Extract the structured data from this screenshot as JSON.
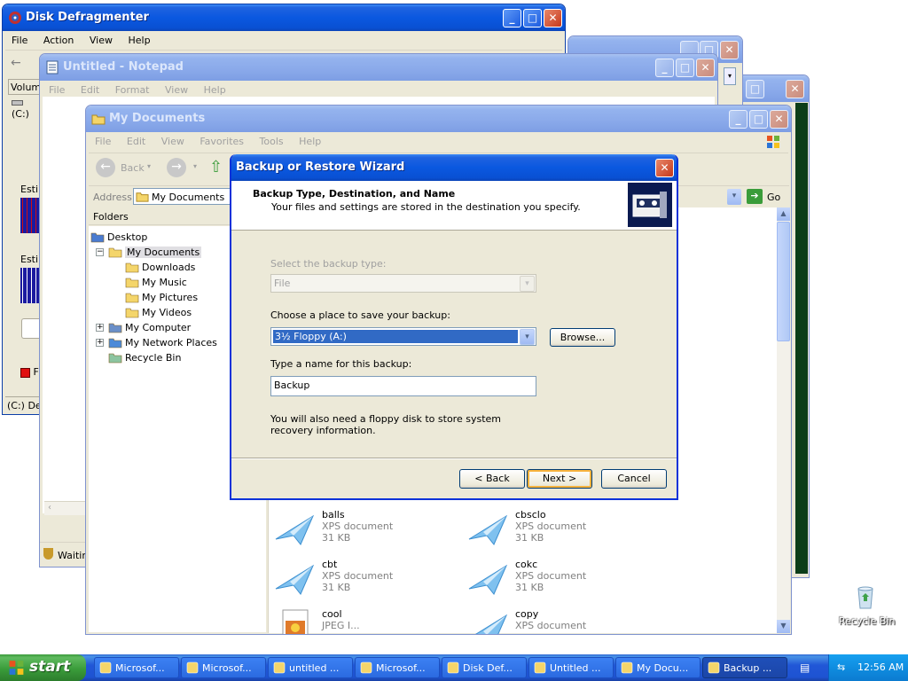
{
  "windows": {
    "defrag": {
      "title": "Disk Defragmenter",
      "menu": [
        "File",
        "Action",
        "View",
        "Help"
      ],
      "col_volume": "Volum",
      "drive": "(C:)",
      "estimated1": "Estim",
      "estimated2": "Estim",
      "legend_frag": "F",
      "status": "(C:) Def"
    },
    "notepad": {
      "title": "Untitled - Notepad",
      "menu": [
        "File",
        "Edit",
        "Format",
        "View",
        "Help"
      ],
      "status_text": "Waitin"
    },
    "mydocs": {
      "title": "My Documents",
      "menu": [
        "File",
        "Edit",
        "View",
        "Favorites",
        "Tools",
        "Help"
      ],
      "back_label": "Back",
      "address_label": "Address",
      "address_value": "My Documents",
      "go_label": "Go",
      "folders_label": "Folders",
      "tree": [
        {
          "label": "Desktop",
          "level": 0,
          "icon": "desktop-icon",
          "exp": ""
        },
        {
          "label": "My Documents",
          "level": 1,
          "icon": "folder-open-icon",
          "exp": "−",
          "selected": true
        },
        {
          "label": "Downloads",
          "level": 2,
          "icon": "folder-icon",
          "exp": ""
        },
        {
          "label": "My Music",
          "level": 2,
          "icon": "music-folder-icon",
          "exp": ""
        },
        {
          "label": "My Pictures",
          "level": 2,
          "icon": "pictures-folder-icon",
          "exp": ""
        },
        {
          "label": "My Videos",
          "level": 2,
          "icon": "videos-folder-icon",
          "exp": ""
        },
        {
          "label": "My Computer",
          "level": 1,
          "icon": "computer-icon",
          "exp": "+"
        },
        {
          "label": "My Network Places",
          "level": 1,
          "icon": "network-icon",
          "exp": "+"
        },
        {
          "label": "Recycle Bin",
          "level": 1,
          "icon": "recycle-bin-icon",
          "exp": ""
        }
      ],
      "files": [
        {
          "name": "balls",
          "type": "XPS document",
          "size": "31 KB",
          "icon": "xps-icon"
        },
        {
          "name": "cbsclo",
          "type": "XPS document",
          "size": "31 KB",
          "icon": "xps-icon"
        },
        {
          "name": "cbt",
          "type": "XPS document",
          "size": "31 KB",
          "icon": "xps-icon"
        },
        {
          "name": "cokc",
          "type": "XPS document",
          "size": "31 KB",
          "icon": "xps-icon"
        },
        {
          "name": "cool",
          "type": "JPEG I...",
          "size": "",
          "icon": "jpeg-icon"
        },
        {
          "name": "copy",
          "type": "XPS document",
          "size": "",
          "icon": "xps-icon"
        }
      ]
    },
    "wizard": {
      "title": "Backup or Restore Wizard",
      "heading": "Backup Type, Destination, and Name",
      "subheading": "Your files and settings are stored in the destination you specify.",
      "type_label": "Select the backup type:",
      "type_value": "File",
      "place_label": "Choose a place to save your backup:",
      "place_value": "3½ Floppy (A:)",
      "browse_label": "Browse...",
      "name_label": "Type a name for this backup:",
      "name_value": "Backup",
      "note": "You will also need a floppy disk to store system recovery information.",
      "back_label": "< Back",
      "next_label": "Next >",
      "cancel_label": "Cancel"
    }
  },
  "desktop": {
    "recycle_bin_label": "Recycle Bin"
  },
  "taskbar": {
    "start_label": "start",
    "items": [
      {
        "label": "Microsof...",
        "icon": "word-icon"
      },
      {
        "label": "Microsof...",
        "icon": "paint-icon"
      },
      {
        "label": "untitled ...",
        "icon": "paint-brush-icon"
      },
      {
        "label": "Microsof...",
        "icon": "ie-icon"
      },
      {
        "label": "Disk Def...",
        "icon": "defrag-icon"
      },
      {
        "label": "Untitled ...",
        "icon": "notepad-icon"
      },
      {
        "label": "My Docu...",
        "icon": "folder-icon"
      },
      {
        "label": "Backup ...",
        "icon": "backup-icon",
        "active": true
      }
    ],
    "clock": "12:56 AM"
  },
  "colors": {
    "xp_blue": "#0a58e0",
    "start_green": "#3a9c3a",
    "dark_green_window": "#0b3d18"
  }
}
